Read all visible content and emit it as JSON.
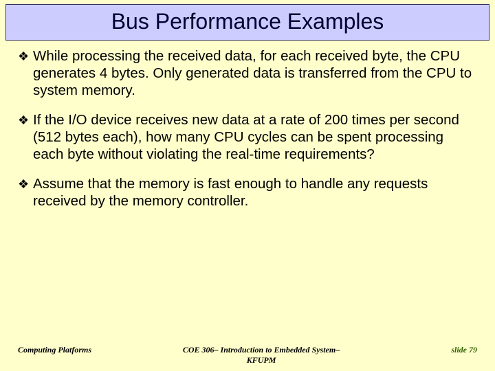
{
  "title": "Bus Performance Examples",
  "bullets": [
    "While processing the received data, for each received byte, the CPU generates 4 bytes. Only generated data is transferred from the CPU to system memory.",
    "If the I/O device receives new data at a rate of 200 times per second (512  bytes each), how many CPU cycles can be spent processing each byte without violating the real-time requirements?",
    "Assume that the memory is fast enough to handle any requests received by the memory controller."
  ],
  "footer": {
    "left": "Computing Platforms",
    "center": "COE 306– Introduction to Embedded System– KFUPM",
    "right": "slide 79"
  },
  "colors": {
    "background": "#ffffcc",
    "title_bg": "#ccccff",
    "title_border": "#333366",
    "footer_right": "#336600"
  }
}
